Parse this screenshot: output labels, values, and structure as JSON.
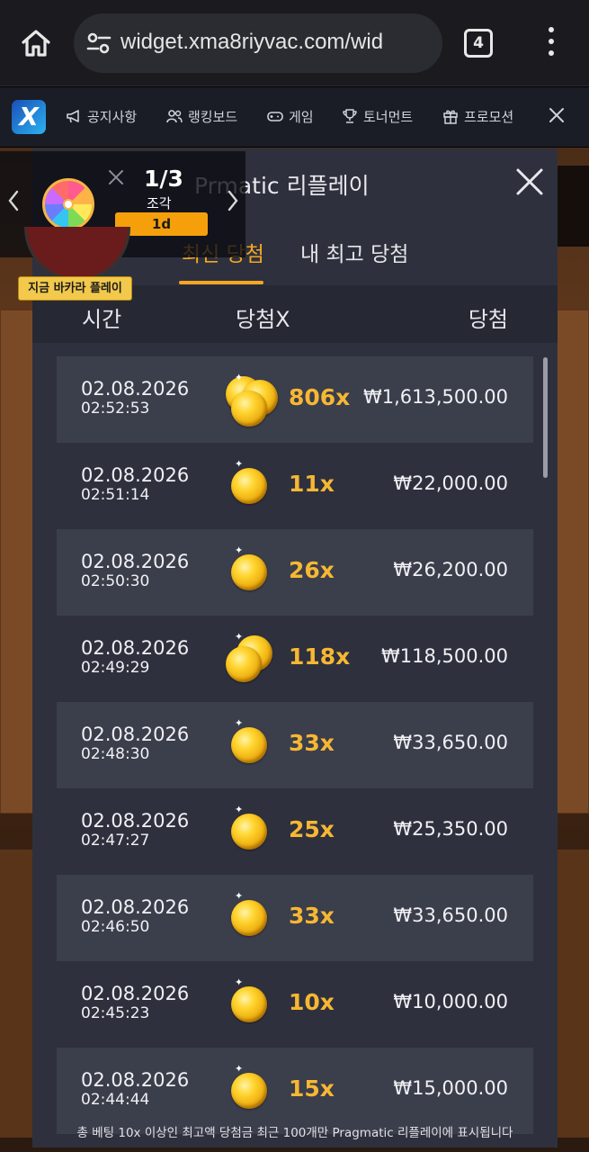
{
  "browser": {
    "url": "widget.xma8riyvac.com/wid",
    "tab_count": "4"
  },
  "site_nav": {
    "items": [
      {
        "label": "공지사항",
        "icon": "megaphone-icon"
      },
      {
        "label": "랭킹보드",
        "icon": "users-icon"
      },
      {
        "label": "게임",
        "icon": "gamepad-icon"
      },
      {
        "label": "토너먼트",
        "icon": "trophy-icon"
      },
      {
        "label": "프로모션",
        "icon": "gift-icon"
      }
    ]
  },
  "widget": {
    "count": "1/3",
    "label": "조각",
    "badge": "1d",
    "play_label": "지금 바카라 플레이"
  },
  "popup": {
    "title_visible": "matic 리플레이",
    "title_left_fragment": "Pr",
    "tabs": [
      {
        "label": "최신 당첨",
        "active": true
      },
      {
        "label": "내 최고 당첨",
        "active": false
      }
    ],
    "columns": {
      "time": "시간",
      "multiplier": "당첨X",
      "win": "당첨"
    },
    "rows": [
      {
        "date": "02.08.2026",
        "time": "02:52:53",
        "multiplier": "806x",
        "win": "₩1,613,500.00",
        "coins": 3
      },
      {
        "date": "02.08.2026",
        "time": "02:51:14",
        "multiplier": "11x",
        "win": "₩22,000.00",
        "coins": 1
      },
      {
        "date": "02.08.2026",
        "time": "02:50:30",
        "multiplier": "26x",
        "win": "₩26,200.00",
        "coins": 1
      },
      {
        "date": "02.08.2026",
        "time": "02:49:29",
        "multiplier": "118x",
        "win": "₩118,500.00",
        "coins": 2
      },
      {
        "date": "02.08.2026",
        "time": "02:48:30",
        "multiplier": "33x",
        "win": "₩33,650.00",
        "coins": 1
      },
      {
        "date": "02.08.2026",
        "time": "02:47:27",
        "multiplier": "25x",
        "win": "₩25,350.00",
        "coins": 1
      },
      {
        "date": "02.08.2026",
        "time": "02:46:50",
        "multiplier": "33x",
        "win": "₩33,650.00",
        "coins": 1
      },
      {
        "date": "02.08.2026",
        "time": "02:45:23",
        "multiplier": "10x",
        "win": "₩10,000.00",
        "coins": 1
      },
      {
        "date": "02.08.2026",
        "time": "02:44:44",
        "multiplier": "15x",
        "win": "₩15,000.00",
        "coins": 1
      }
    ],
    "footer_note": "총 베팅 10x 이상인 최고액 당첨금 최근 100개만 Pragmatic 리플레이에 표시됩니다"
  },
  "colors": {
    "accent": "#f5a623",
    "multiplier": "#f7b733",
    "panel": "#2e313d",
    "row_alt": "#3b3e4b"
  }
}
